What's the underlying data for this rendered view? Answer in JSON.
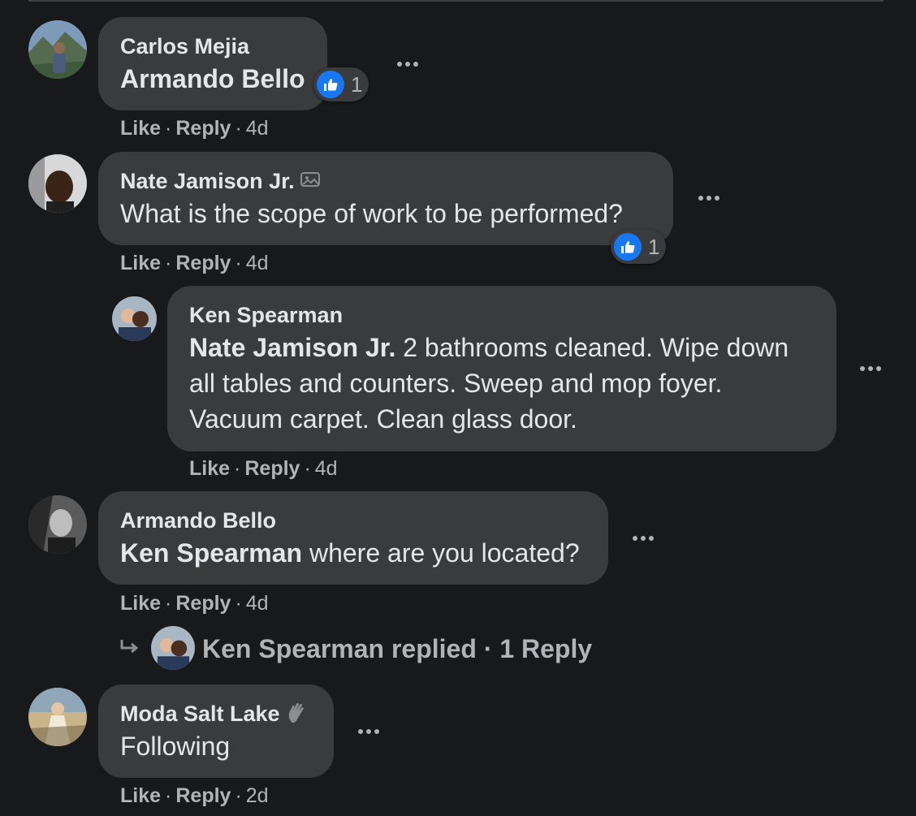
{
  "comments": [
    {
      "author": "Carlos Mejia",
      "mention": "Armando Bello",
      "text": "",
      "reaction_count": "1",
      "actions": {
        "like": "Like",
        "reply": "Reply",
        "time": "4d"
      }
    },
    {
      "author": "Nate Jamison Jr.",
      "mention": "",
      "text": "What is the scope of work to be performed?",
      "reaction_count": "1",
      "actions": {
        "like": "Like",
        "reply": "Reply",
        "time": "4d"
      }
    },
    {
      "author": "Ken Spearman",
      "mention": "Nate Jamison Jr.",
      "text_line1": " 2 bathrooms cleaned. Wipe down",
      "text_line2": "all tables and counters. Sweep and mop foyer.",
      "text_line3": "Vacuum carpet. Clean glass door.",
      "actions": {
        "like": "Like",
        "reply": "Reply",
        "time": "4d"
      }
    },
    {
      "author": "Armando Bello",
      "mention": "Ken Spearman",
      "text": " where are you located?",
      "actions": {
        "like": "Like",
        "reply": "Reply",
        "time": "4d"
      }
    },
    {
      "author": "Moda Salt Lake",
      "mention": "",
      "text": "Following",
      "actions": {
        "like": "Like",
        "reply": "Reply",
        "time": "2d"
      }
    }
  ],
  "replies_summary": {
    "text": "Ken Spearman replied · 1 Reply"
  },
  "separators": {
    "dot": "·"
  },
  "colors": {
    "background": "#18191a",
    "bubble": "#3a3b3c",
    "text": "#e4e6eb",
    "secondary": "#b0b3b8",
    "like_blue": "#1877f2"
  },
  "icons": [
    "thumbs-up-icon",
    "more-dots-icon",
    "photo-badge-icon",
    "wave-hand-icon",
    "reply-arrow-icon"
  ]
}
